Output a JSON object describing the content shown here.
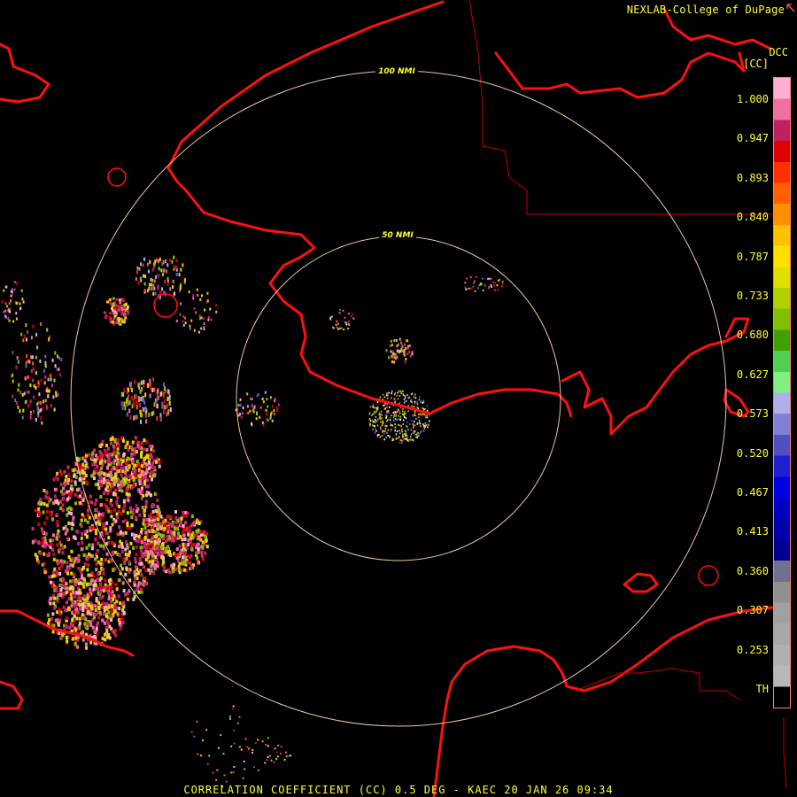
{
  "credit": "NEXLAB-College of DuPage",
  "product": {
    "code": "DCC",
    "unit": "[CC]",
    "footer": "CORRELATION COEFFICIENT (CC) 0.5 DEG - KAEC 20 JAN 26 09:34"
  },
  "range_rings": [
    {
      "label": "50 NMI"
    },
    {
      "label": "100 NMI"
    }
  ],
  "legend": {
    "ticks": [
      "1.000",
      "0.947",
      "0.893",
      "0.840",
      "0.787",
      "0.733",
      "0.680",
      "0.627",
      "0.573",
      "0.520",
      "0.467",
      "0.413",
      "0.360",
      "0.307",
      "0.253",
      "TH"
    ],
    "colors": [
      "#ffb0d0",
      "#f070a0",
      "#c02060",
      "#e00000",
      "#ff3000",
      "#ff6000",
      "#ff9000",
      "#ffc000",
      "#ffe000",
      "#e0e000",
      "#b0d000",
      "#80c000",
      "#40a000",
      "#50d050",
      "#80f080",
      "#b0b0e8",
      "#8080d8",
      "#5050c0",
      "#2020d0",
      "#0000e0",
      "#0000c0",
      "#0000a8",
      "#000090",
      "#707090",
      "#909090",
      "#a0a0a0",
      "#a8a8a8",
      "#b0b0b0",
      "#b8b8b8",
      "#000000"
    ]
  },
  "colors": {
    "coastline": "#ff1010",
    "border": "#c00000",
    "ring": "#e8c8a0",
    "text": "#ffff33"
  }
}
